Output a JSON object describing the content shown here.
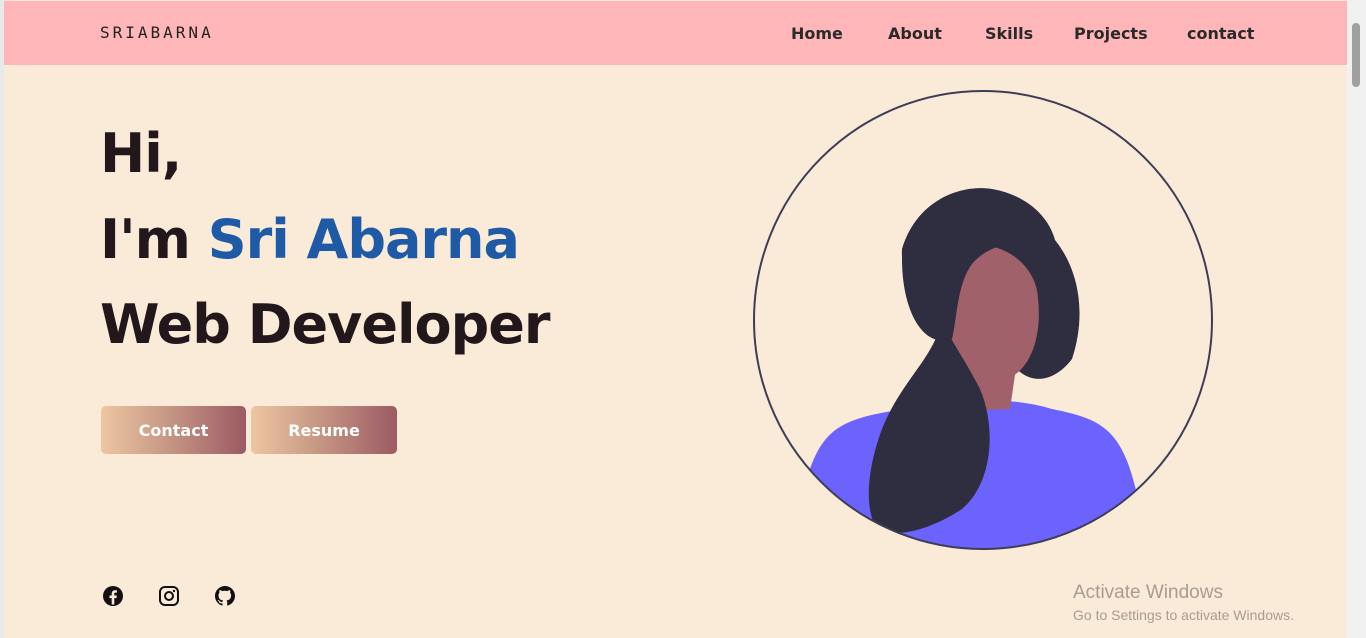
{
  "navbar": {
    "logo": "SRIABARNA",
    "links": [
      {
        "label": "Home"
      },
      {
        "label": "About"
      },
      {
        "label": "Skills"
      },
      {
        "label": "Projects"
      },
      {
        "label": "contact"
      }
    ]
  },
  "hero": {
    "greeting": "Hi,",
    "intro_prefix": "I'm ",
    "name": "Sri Abarna",
    "role": "Web Developer",
    "buttons": {
      "contact": "Contact",
      "resume": "Resume"
    }
  },
  "social": {
    "icons": [
      "facebook-icon",
      "instagram-icon",
      "github-icon"
    ]
  },
  "colors": {
    "navbar_bg": "#ffb6b9",
    "page_bg": "#f9ebd8",
    "accent_name": "#1f5aa6",
    "heading": "#22181c"
  },
  "watermark": {
    "title": "Activate Windows",
    "subtitle": "Go to Settings to activate Windows."
  }
}
